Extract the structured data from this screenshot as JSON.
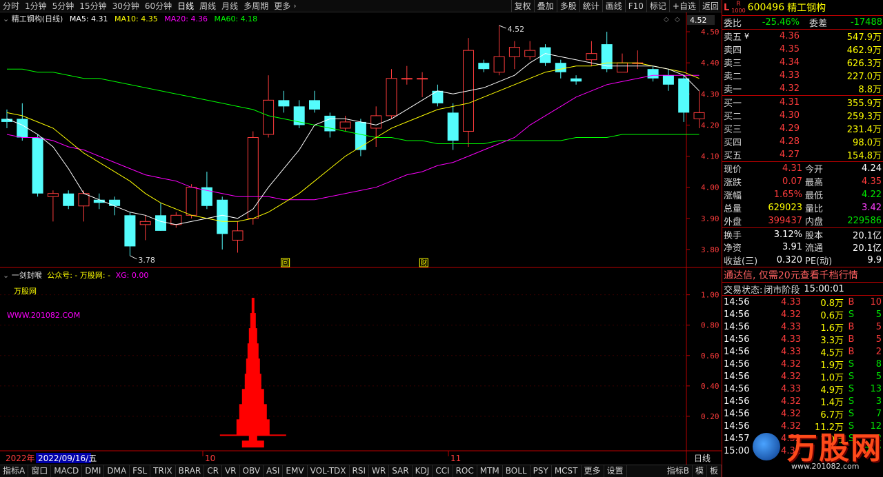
{
  "topbar": {
    "tabs": [
      "分时",
      "1分钟",
      "5分钟",
      "15分钟",
      "30分钟",
      "60分钟",
      "日线",
      "周线",
      "月线",
      "多周期",
      "更多"
    ],
    "active": "日线",
    "tools": [
      "复权",
      "叠加",
      "多股",
      "统计",
      "画线",
      "F10",
      "标记",
      "+自选",
      "返回"
    ]
  },
  "main": {
    "title": "精工钢构(日线)",
    "ma5": "MA5: 4.31",
    "ma10": "MA10: 4.35",
    "ma20": "MA20: 4.36",
    "ma60": "MA60: 4.18",
    "colors": {
      "ma5": "#ffffff",
      "ma10": "#ffff00",
      "ma20": "#ff00ff",
      "ma60": "#00ff00",
      "up": "#ff3c3c",
      "down": "#54fcfc"
    },
    "high_label": "4.52",
    "low_label": "3.78",
    "price_tag": "4.52",
    "y_ticks": [
      "4.50",
      "4.40",
      "4.30",
      "4.20",
      "4.10",
      "4.00",
      "3.90",
      "3.80"
    ],
    "markers": [
      "回",
      "财"
    ]
  },
  "chart_data": {
    "type": "candlestick",
    "title": "精工钢构(日线)",
    "ylim": [
      3.76,
      4.54
    ],
    "candles": [
      {
        "o": 4.22,
        "c": 4.21,
        "h": 4.25,
        "l": 4.19
      },
      {
        "o": 4.22,
        "c": 4.16,
        "h": 4.27,
        "l": 4.15
      },
      {
        "o": 4.16,
        "c": 3.98,
        "h": 4.17,
        "l": 3.97
      },
      {
        "o": 3.97,
        "c": 3.98,
        "h": 3.99,
        "l": 3.89
      },
      {
        "o": 3.98,
        "c": 3.94,
        "h": 3.99,
        "l": 3.93
      },
      {
        "o": 3.94,
        "c": 3.98,
        "h": 3.99,
        "l": 3.89
      },
      {
        "o": 3.96,
        "c": 3.95,
        "h": 3.98,
        "l": 3.93
      },
      {
        "o": 3.96,
        "c": 3.94,
        "h": 3.97,
        "l": 3.91
      },
      {
        "o": 3.91,
        "c": 3.81,
        "h": 3.92,
        "l": 3.78
      },
      {
        "o": 3.88,
        "c": 3.89,
        "h": 3.91,
        "l": 3.83
      },
      {
        "o": 3.91,
        "c": 3.86,
        "h": 3.95,
        "l": 3.86
      },
      {
        "o": 3.88,
        "c": 3.91,
        "h": 3.92,
        "l": 3.87
      },
      {
        "o": 3.91,
        "c": 4.0,
        "h": 4.01,
        "l": 3.9
      },
      {
        "o": 4.0,
        "c": 3.94,
        "h": 4.05,
        "l": 3.93
      },
      {
        "o": 3.96,
        "c": 3.85,
        "h": 3.97,
        "l": 3.8
      },
      {
        "o": 3.83,
        "c": 3.86,
        "h": 3.89,
        "l": 3.79
      },
      {
        "o": 3.9,
        "c": 4.16,
        "h": 4.18,
        "l": 3.88
      },
      {
        "o": 4.17,
        "c": 4.28,
        "h": 4.36,
        "l": 4.16
      },
      {
        "o": 4.28,
        "c": 4.26,
        "h": 4.31,
        "l": 4.24
      },
      {
        "o": 4.26,
        "c": 4.2,
        "h": 4.28,
        "l": 4.19
      },
      {
        "o": 4.28,
        "c": 4.25,
        "h": 4.31,
        "l": 4.24
      },
      {
        "o": 4.23,
        "c": 4.18,
        "h": 4.24,
        "l": 4.16
      },
      {
        "o": 4.19,
        "c": 4.21,
        "h": 4.23,
        "l": 4.18
      },
      {
        "o": 4.21,
        "c": 4.12,
        "h": 4.22,
        "l": 4.1
      },
      {
        "o": 4.19,
        "c": 4.23,
        "h": 4.26,
        "l": 4.13
      },
      {
        "o": 4.23,
        "c": 4.35,
        "h": 4.38,
        "l": 4.22
      },
      {
        "o": 4.35,
        "c": 4.35,
        "h": 4.39,
        "l": 4.33
      },
      {
        "o": 4.35,
        "c": 4.35,
        "h": 4.37,
        "l": 4.29
      },
      {
        "o": 4.31,
        "c": 4.27,
        "h": 4.33,
        "l": 4.26
      },
      {
        "o": 4.24,
        "c": 4.15,
        "h": 4.27,
        "l": 4.12
      },
      {
        "o": 4.18,
        "c": 4.44,
        "h": 4.48,
        "l": 4.13
      },
      {
        "o": 4.4,
        "c": 4.38,
        "h": 4.41,
        "l": 4.37
      },
      {
        "o": 4.37,
        "c": 4.42,
        "h": 4.52,
        "l": 4.36
      },
      {
        "o": 4.42,
        "c": 4.45,
        "h": 4.47,
        "l": 4.38
      },
      {
        "o": 4.42,
        "c": 4.44,
        "h": 4.47,
        "l": 4.41
      },
      {
        "o": 4.45,
        "c": 4.4,
        "h": 4.46,
        "l": 4.39
      },
      {
        "o": 4.4,
        "c": 4.37,
        "h": 4.41,
        "l": 4.35
      },
      {
        "o": 4.35,
        "c": 4.34,
        "h": 4.36,
        "l": 4.33
      },
      {
        "o": 4.41,
        "c": 4.43,
        "h": 4.47,
        "l": 4.39
      },
      {
        "o": 4.46,
        "c": 4.38,
        "h": 4.5,
        "l": 4.37
      },
      {
        "o": 4.37,
        "c": 4.4,
        "h": 4.43,
        "l": 4.37
      },
      {
        "o": 4.4,
        "c": 4.4,
        "h": 4.44,
        "l": 4.38
      },
      {
        "o": 4.38,
        "c": 4.35,
        "h": 4.39,
        "l": 4.34
      },
      {
        "o": 4.36,
        "c": 4.33,
        "h": 4.38,
        "l": 4.31
      },
      {
        "o": 4.35,
        "c": 4.24,
        "h": 4.36,
        "l": 4.21
      },
      {
        "o": 4.22,
        "c": 4.24,
        "h": 4.31,
        "l": 4.19
      }
    ],
    "ma5": [
      4.22,
      4.2,
      4.17,
      4.13,
      4.06,
      3.98,
      3.96,
      3.94,
      3.92,
      3.91,
      3.89,
      3.88,
      3.89,
      3.9,
      3.91,
      3.9,
      3.93,
      4.0,
      4.06,
      4.12,
      4.2,
      4.22,
      4.22,
      4.21,
      4.2,
      4.22,
      4.25,
      4.28,
      4.31,
      4.3,
      4.31,
      4.32,
      4.34,
      4.36,
      4.4,
      4.43,
      4.42,
      4.41,
      4.4,
      4.39,
      4.39,
      4.39,
      4.39,
      4.38,
      4.36,
      4.31
    ],
    "ma10": [
      4.24,
      4.23,
      4.21,
      4.19,
      4.15,
      4.11,
      4.08,
      4.05,
      4.02,
      3.98,
      3.95,
      3.93,
      3.91,
      3.9,
      3.89,
      3.89,
      3.9,
      3.92,
      3.95,
      3.98,
      4.02,
      4.06,
      4.1,
      4.13,
      4.16,
      4.19,
      4.21,
      4.23,
      4.25,
      4.26,
      4.27,
      4.29,
      4.31,
      4.33,
      4.35,
      4.37,
      4.38,
      4.39,
      4.39,
      4.4,
      4.4,
      4.4,
      4.39,
      4.38,
      4.37,
      4.35
    ],
    "ma20": [
      4.17,
      4.16,
      4.16,
      4.15,
      4.13,
      4.12,
      4.1,
      4.08,
      4.06,
      4.04,
      4.03,
      4.02,
      4.0,
      3.99,
      3.98,
      3.97,
      3.97,
      3.97,
      3.96,
      3.96,
      3.96,
      3.97,
      3.98,
      3.99,
      4.0,
      4.02,
      4.04,
      4.05,
      4.07,
      4.08,
      4.1,
      4.12,
      4.14,
      4.16,
      4.2,
      4.23,
      4.26,
      4.29,
      4.31,
      4.33,
      4.34,
      4.35,
      4.36,
      4.36,
      4.36,
      4.36
    ],
    "ma60": [
      4.38,
      4.38,
      4.37,
      4.37,
      4.36,
      4.35,
      4.35,
      4.34,
      4.33,
      4.32,
      4.31,
      4.3,
      4.29,
      4.28,
      4.27,
      4.26,
      4.25,
      4.23,
      4.22,
      4.21,
      4.2,
      4.19,
      4.18,
      4.17,
      4.16,
      4.16,
      4.15,
      4.15,
      4.14,
      4.14,
      4.14,
      4.14,
      4.15,
      4.15,
      4.15,
      4.15,
      4.15,
      4.16,
      4.16,
      4.16,
      4.17,
      4.17,
      4.17,
      4.17,
      4.17,
      4.17
    ],
    "signal": {
      "start": 15.8,
      "end": 18.0,
      "levels": [
        0.98,
        0.88,
        0.78,
        0.68,
        0.58,
        0.48,
        0.38,
        0.28,
        0.18,
        0.08
      ]
    }
  },
  "sub": {
    "title": "一剑封喉",
    "line2": "公众号: - 万股网: -",
    "xg": "XG: 0.00",
    "wm1": "万股网",
    "wm2": "WWW.201082.COM",
    "y_ticks": [
      "1.00",
      "0.80",
      "0.60",
      "0.40",
      "0.20"
    ]
  },
  "xaxis": {
    "year": "2022年",
    "date": "2022/09/16/五",
    "m10": "10",
    "m11": "11",
    "period": "日线"
  },
  "bottombar": [
    "指标A",
    "窗口",
    "MACD",
    "DMI",
    "DMA",
    "FSL",
    "TRIX",
    "BRAR",
    "CR",
    "VR",
    "OBV",
    "ASI",
    "EMV",
    "VOL-TDX",
    "RSI",
    "WR",
    "SAR",
    "KDJ",
    "CCI",
    "ROC",
    "MTM",
    "BOLL",
    "PSY",
    "MCST",
    "更多",
    "设置",
    "指标B",
    "模",
    "板"
  ],
  "right": {
    "code": "600496",
    "name": "精工钢构",
    "badge_l": "L",
    "badge_r": "R",
    "badge_n": "1000",
    "wb_lbl": "委比",
    "wb": "-25.46%",
    "wc_lbl": "委差",
    "wc": "-17488",
    "asks": [
      {
        "l": "卖五",
        "y": "¥",
        "p": "4.36",
        "v": "547.9万"
      },
      {
        "l": "卖四",
        "p": "4.35",
        "v": "462.9万"
      },
      {
        "l": "卖三",
        "p": "4.34",
        "v": "626.3万"
      },
      {
        "l": "卖二",
        "p": "4.33",
        "v": "227.0万"
      },
      {
        "l": "卖一",
        "p": "4.32",
        "v": "8.8万"
      }
    ],
    "bids": [
      {
        "l": "买一",
        "p": "4.31",
        "v": "355.9万"
      },
      {
        "l": "买二",
        "p": "4.30",
        "v": "259.3万"
      },
      {
        "l": "买三",
        "p": "4.29",
        "v": "231.4万"
      },
      {
        "l": "买四",
        "p": "4.28",
        "v": "98.0万"
      },
      {
        "l": "买五",
        "p": "4.27",
        "v": "154.8万"
      }
    ],
    "q": [
      {
        "a": "现价",
        "av": "4.31",
        "ac": "red",
        "b": "今开",
        "bv": "4.24",
        "bc": "white"
      },
      {
        "a": "涨跌",
        "av": "0.07",
        "ac": "red",
        "b": "最高",
        "bv": "4.35",
        "bc": "red"
      },
      {
        "a": "涨幅",
        "av": "1.65%",
        "ac": "red",
        "b": "最低",
        "bv": "4.22",
        "bc": "green"
      },
      {
        "a": "总量",
        "av": "629023",
        "ac": "yellow",
        "b": "量比",
        "bv": "3.42",
        "bc": "mag"
      },
      {
        "a": "外盘",
        "av": "399437",
        "ac": "red",
        "b": "内盘",
        "bv": "229586",
        "bc": "green"
      },
      {
        "a": "换手",
        "av": "3.12%",
        "ac": "white",
        "b": "股本",
        "bv": "20.1亿",
        "bc": "white"
      },
      {
        "a": "净资",
        "av": "3.91",
        "ac": "white",
        "b": "流通",
        "bv": "20.1亿",
        "bc": "white"
      },
      {
        "a": "收益(三)",
        "av": "0.320",
        "ac": "white",
        "b": "PE(动)",
        "bv": "9.9",
        "bc": "white"
      }
    ],
    "ad": "通达信, 仅需20元查看千档行情",
    "status_lbl": "交易状态:",
    "status": "闭市阶段",
    "status_time": "15:00:01",
    "ticks": [
      {
        "t": "14:56",
        "p": "4.33",
        "v": "0.8万",
        "s": "B",
        "n": "10"
      },
      {
        "t": "14:56",
        "p": "4.32",
        "v": "0.6万",
        "s": "S",
        "n": "5"
      },
      {
        "t": "14:56",
        "p": "4.33",
        "v": "1.6万",
        "s": "B",
        "n": "5"
      },
      {
        "t": "14:56",
        "p": "4.33",
        "v": "3.3万",
        "s": "B",
        "n": "5"
      },
      {
        "t": "14:56",
        "p": "4.33",
        "v": "4.5万",
        "s": "B",
        "n": "2"
      },
      {
        "t": "14:56",
        "p": "4.32",
        "v": "1.9万",
        "s": "S",
        "n": "8"
      },
      {
        "t": "14:56",
        "p": "4.32",
        "v": "1.0万",
        "s": "S",
        "n": "5"
      },
      {
        "t": "14:56",
        "p": "4.33",
        "v": "4.9万",
        "s": "S",
        "n": "13"
      },
      {
        "t": "14:56",
        "p": "4.32",
        "v": "1.4万",
        "s": "S",
        "n": "3"
      },
      {
        "t": "14:56",
        "p": "4.32",
        "v": "6.7万",
        "s": "S",
        "n": "7"
      },
      {
        "t": "14:56",
        "p": "4.32",
        "v": "11.2万",
        "s": "S",
        "n": "12"
      },
      {
        "t": "14:57",
        "p": "4.32",
        "v": "1.0万",
        "s": "S",
        "n": "2"
      },
      {
        "t": "15:00",
        "p": "4.31",
        "v": "",
        "s": "",
        "n": "217"
      }
    ],
    "logo": "万股网",
    "logo_url": "www.201082.com"
  }
}
